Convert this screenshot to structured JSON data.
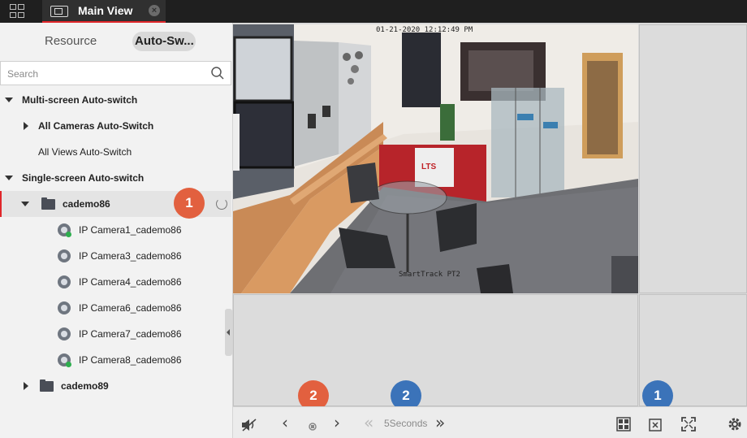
{
  "window": {
    "tab_title": "Main View"
  },
  "sidebar": {
    "tabs": [
      {
        "label": "Resource"
      },
      {
        "label": "Auto-Sw..."
      }
    ],
    "search": {
      "placeholder": "Search"
    },
    "tree": [
      {
        "label": "Multi-screen Auto-switch",
        "level": 0,
        "expanded": true
      },
      {
        "label": "All Cameras Auto-Switch",
        "level": 1,
        "expanded": false
      },
      {
        "label": "All Views Auto-Switch",
        "level": 1
      },
      {
        "label": "Single-screen Auto-switch",
        "level": 0,
        "expanded": true
      },
      {
        "label": "cademo86",
        "level": 1,
        "expanded": true,
        "selected": true
      },
      {
        "label": "IP Camera1_cademo86",
        "level": 2,
        "online": true
      },
      {
        "label": "IP Camera3_cademo86",
        "level": 2
      },
      {
        "label": "IP Camera4_cademo86",
        "level": 2
      },
      {
        "label": "IP Camera6_cademo86",
        "level": 2
      },
      {
        "label": "IP Camera7_cademo86",
        "level": 2
      },
      {
        "label": "IP Camera8_cademo86",
        "level": 2,
        "online": true
      },
      {
        "label": "cademo89",
        "level": 1,
        "expanded": false
      }
    ]
  },
  "video": {
    "timestamp": "01-21-2020 12:12:49 PM",
    "camera_label": "SmartTrack PT2"
  },
  "badges": {
    "red_1": "1",
    "red_2": "2",
    "blue_2": "2",
    "blue_1": "1"
  },
  "toolbar": {
    "interval_label": "5Seconds"
  },
  "colors": {
    "accent_red": "#e0262a",
    "badge_red": "#e2603f",
    "badge_blue": "#3b73b9",
    "titlebar": "#1f1f1f"
  }
}
